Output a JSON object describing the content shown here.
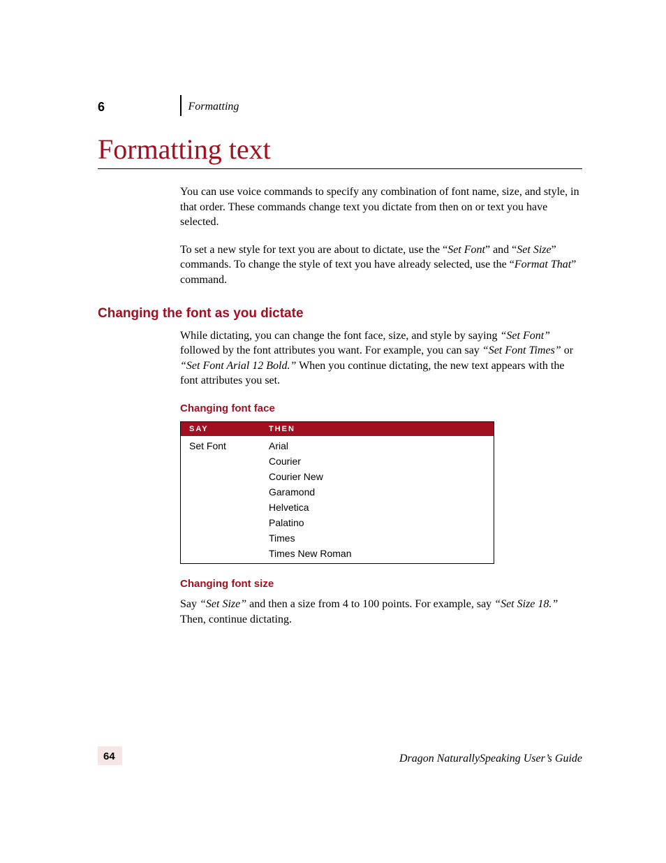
{
  "header": {
    "chapter_number": "6",
    "chapter_name": "Formatting"
  },
  "title": "Formatting text",
  "intro": {
    "p1": "You can use voice commands to specify any combination of font name, size, and style, in that order. These commands change text you dictate from then on or text you have selected.",
    "p2_pre": "To set a new style for text you are about to dictate, use the “",
    "p2_cmd1": "Set Font",
    "p2_mid1": "” and “",
    "p2_cmd2": "Set Size",
    "p2_mid2": "” commands. To change the style of text you have already selected, use the “",
    "p2_cmd3": "Format That",
    "p2_post": "” command."
  },
  "section1": {
    "heading": "Changing the font as you dictate",
    "p1_pre": "While dictating, you can change the font face, size, and style by saying ",
    "p1_cmd1": "“Set Font”",
    "p1_mid1": " followed by the font attributes you want. For example, you can say ",
    "p1_cmd2": "“Set Font Times”",
    "p1_mid2": " or ",
    "p1_cmd3": "“Set Font Arial 12 Bold.”",
    "p1_post": " When you continue dictating, the new text appears with the font attributes you set."
  },
  "table1": {
    "caption": "Changing font face",
    "col_say": "Say",
    "col_then": "Then",
    "say_value": "Set Font",
    "then_values": [
      "Arial",
      "Courier",
      "Courier New",
      "Garamond",
      "Helvetica",
      "Palatino",
      "Times",
      "Times New Roman"
    ]
  },
  "section2": {
    "heading": "Changing font size",
    "p1_pre": "Say ",
    "p1_cmd1": "“Set Size”",
    "p1_mid1": " and then a size from 4 to 100 points. For example, say ",
    "p1_cmd2": "“Set Size 18.”",
    "p1_post": " Then, continue dictating."
  },
  "footer": {
    "page_number": "64",
    "book_title": "Dragon NaturallySpeaking User’s Guide"
  }
}
